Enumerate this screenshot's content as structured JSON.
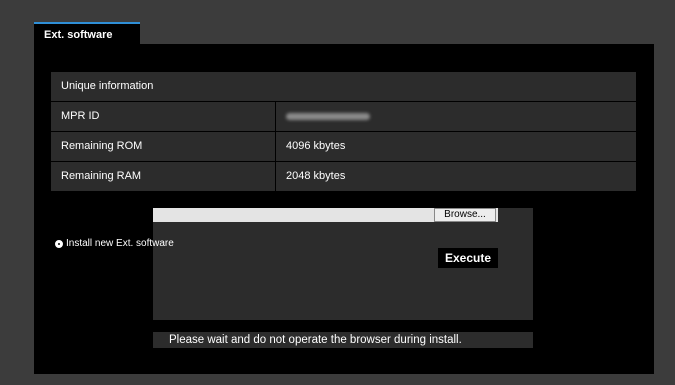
{
  "tab": {
    "label": "Ext. software"
  },
  "info": {
    "header": "Unique information",
    "rows": [
      {
        "label": "MPR ID",
        "value": ""
      },
      {
        "label": "Remaining ROM",
        "value": "4096 kbytes"
      },
      {
        "label": "Remaining RAM",
        "value": "2048 kbytes"
      }
    ]
  },
  "install": {
    "file_path": "",
    "browse_label": "Browse...",
    "option_label": "Install new Ext. software",
    "execute_label": "Execute",
    "notice": "Please wait and do not operate the browser during install."
  },
  "colors": {
    "tab_accent": "#2f8fd6",
    "panel_bg": "#000000",
    "row_bg": "#2c2c2c",
    "page_bg": "#3c3c3c"
  },
  "icons": {
    "radio": "radio-selected-icon"
  }
}
